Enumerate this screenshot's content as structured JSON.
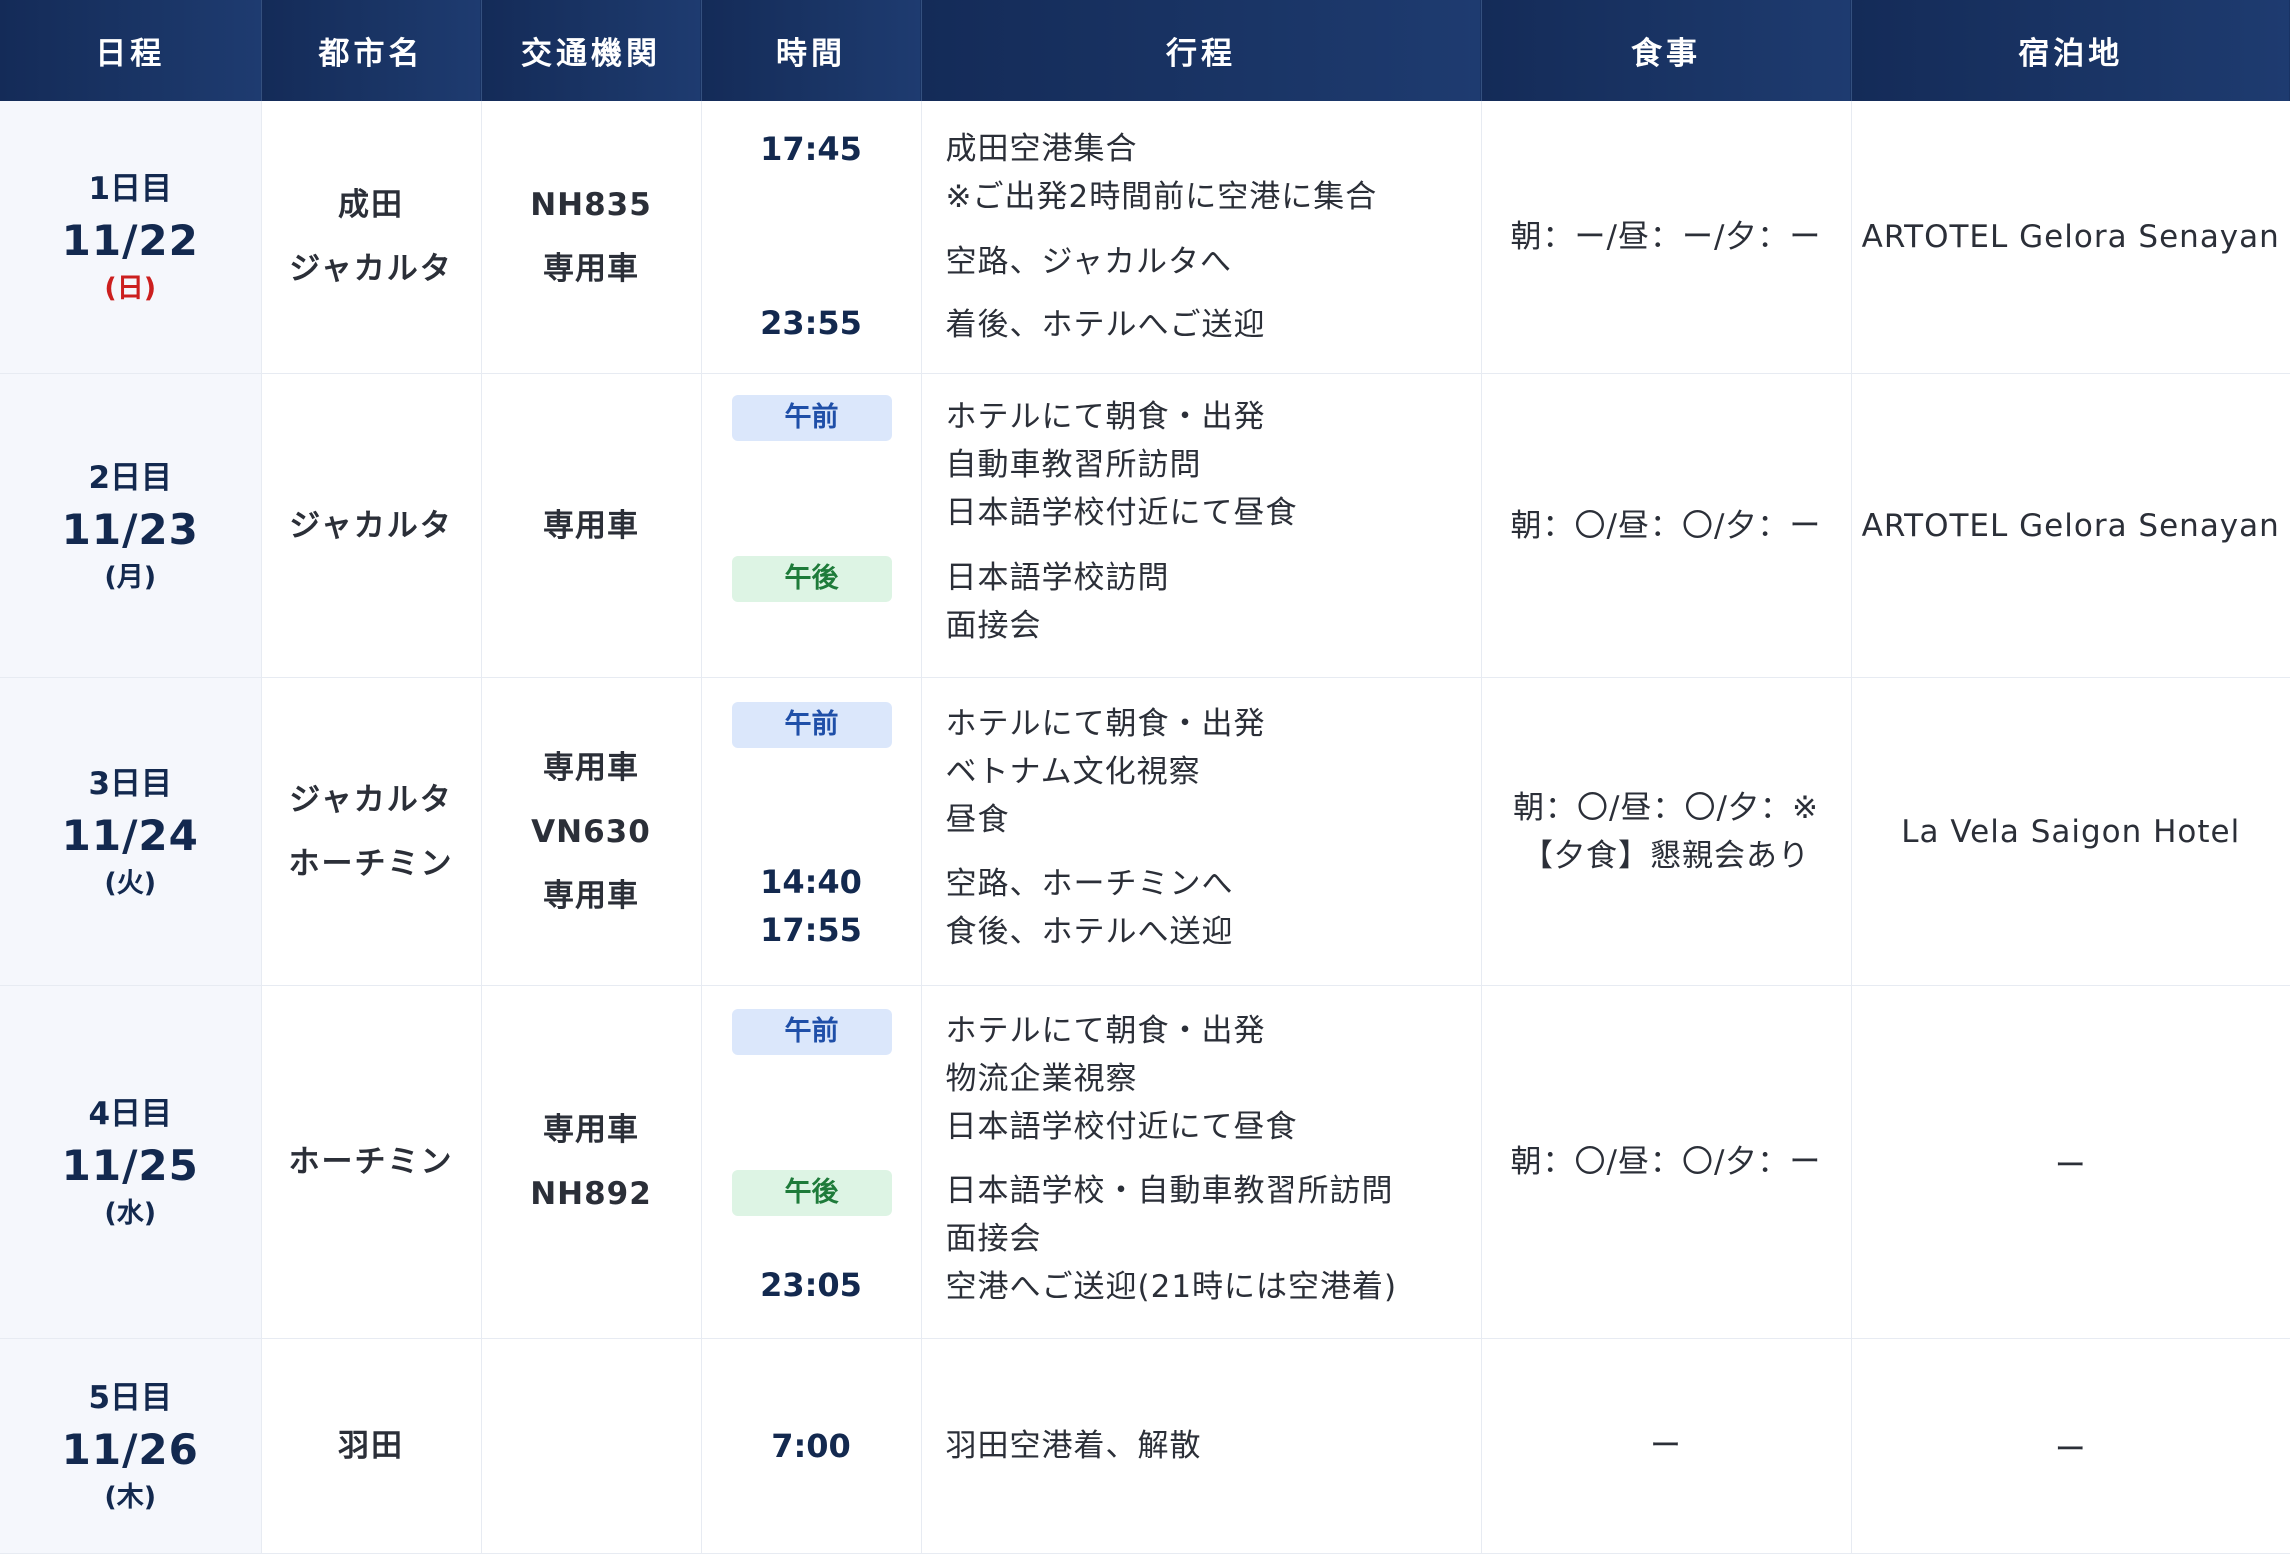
{
  "headers": [
    "日程",
    "都市名",
    "交通機関",
    "時間",
    "行程",
    "食事",
    "宿泊地"
  ],
  "days": [
    {
      "day": "1日目",
      "date": "11/22",
      "weekday": "(日)",
      "cities": [
        "成田",
        "ジャカルタ"
      ],
      "transport": [
        "NH835",
        "専用車"
      ],
      "times": [
        "17:45",
        "23:55"
      ],
      "schedule": [
        "成田空港集合",
        "※ご出発2時間前に空港に集合",
        "空路、ジャカルタへ",
        "着後、ホテルへご送迎"
      ],
      "meals": [
        "朝：ー/昼：ー/夕：ー"
      ],
      "hotel": "ARTOTEL Gelora Senayan"
    },
    {
      "day": "2日目",
      "date": "11/23",
      "weekday": "(月)",
      "cities": [
        "ジャカルタ"
      ],
      "transport": [
        "専用車"
      ],
      "badges": [
        "午前",
        "午後"
      ],
      "schedule": [
        "ホテルにて朝食・出発",
        "自動車教習所訪問",
        "日本語学校付近にて昼食",
        "日本語学校訪問",
        "面接会"
      ],
      "meals": [
        "朝：〇/昼：〇/夕：ー"
      ],
      "hotel": "ARTOTEL Gelora Senayan"
    },
    {
      "day": "3日目",
      "date": "11/24",
      "weekday": "(火)",
      "cities": [
        "ジャカルタ",
        "ホーチミン"
      ],
      "transport": [
        "専用車",
        "VN630",
        "専用車"
      ],
      "badges": [
        "午前"
      ],
      "times": [
        "14:40",
        "17:55"
      ],
      "schedule": [
        "ホテルにて朝食・出発",
        "ベトナム文化視察",
        "昼食",
        "空路、ホーチミンへ",
        "食後、ホテルへ送迎"
      ],
      "meals": [
        "朝：〇/昼：〇/夕：※",
        "【夕食】懇親会あり"
      ],
      "hotel": "La Vela Saigon Hotel"
    },
    {
      "day": "4日目",
      "date": "11/25",
      "weekday": "(水)",
      "cities": [
        "ホーチミン"
      ],
      "transport": [
        "専用車",
        "NH892"
      ],
      "badges": [
        "午前",
        "午後"
      ],
      "times": [
        "23:05"
      ],
      "schedule": [
        "ホテルにて朝食・出発",
        "物流企業視察",
        "日本語学校付近にて昼食",
        "日本語学校・自動車教習所訪問",
        "面接会",
        "空港へご送迎(21時には空港着)"
      ],
      "meals": [
        "朝：〇/昼：〇/夕：ー"
      ],
      "hotel": "ー"
    },
    {
      "day": "5日目",
      "date": "11/26",
      "weekday": "(木)",
      "cities": [
        "羽田"
      ],
      "transport": [],
      "times": [
        "7:00"
      ],
      "schedule": [
        "羽田空港着、解散"
      ],
      "meals": [
        "ー"
      ],
      "hotel": "ー"
    }
  ],
  "colors": {
    "header_bg": "#1a3566",
    "date_text": "#13294f",
    "sunday": "#cc1f1f",
    "am_badge_bg": "#dbe7fb",
    "am_badge_text": "#1f4fa8",
    "pm_badge_bg": "#ddf4e4",
    "pm_badge_text": "#1e7b3a"
  }
}
